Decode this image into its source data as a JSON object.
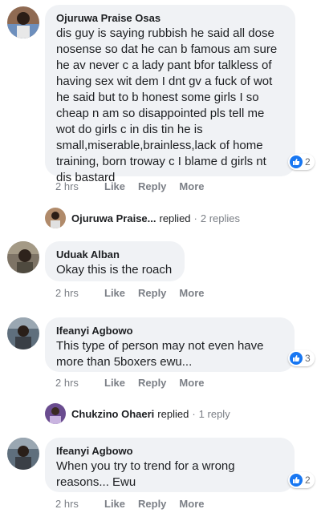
{
  "comments": [
    {
      "author": "Ojuruwa Praise Osas",
      "text": "dis guy is saying rubbish he said all dose nosense so dat he can b famous am sure he av never c a lady pant bfor talkless of having sex wit dem I dnt gv a fuck of wot he said but to b honest some girls I so cheap n am so disappointed pls tell me wot do girls c in dis tin he is small,miserable,brainless,lack of home training, born troway c I blame d girls nt dis bastard",
      "time": "2 hrs",
      "like": "Like",
      "reply": "Reply",
      "more": "More",
      "reactions": "2"
    },
    {
      "author": "Uduak Alban",
      "text": "Okay this is the roach",
      "time": "2 hrs",
      "like": "Like",
      "reply": "Reply",
      "more": "More"
    },
    {
      "author": "Ifeanyi Agbowo",
      "text": "This type of person may not even have more than 5boxers ewu...",
      "time": "2 hrs",
      "like": "Like",
      "reply": "Reply",
      "more": "More",
      "reactions": "3"
    },
    {
      "author": "Ifeanyi Agbowo",
      "text": "When you try to trend for a wrong reasons... Ewu",
      "time": "2 hrs",
      "like": "Like",
      "reply": "Reply",
      "more": "More",
      "reactions": "2"
    }
  ],
  "reply_threads": [
    {
      "name": "Ojuruwa Praise...",
      "verb": "replied",
      "count": "2 replies"
    },
    {
      "name": "Chukzino Ohaeri",
      "verb": "replied",
      "count": "1 reply"
    }
  ],
  "colors": {
    "like_blue": "#1877f2",
    "bubble_bg": "#f0f2f5",
    "meta_gray": "#7b7f86"
  },
  "icons": {
    "reaction": "like-thumb-icon",
    "avatar": "user-avatar"
  }
}
